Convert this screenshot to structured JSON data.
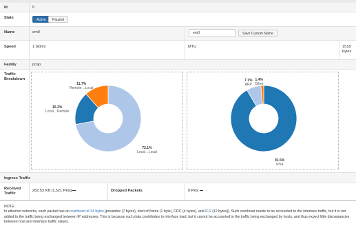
{
  "rows": {
    "id": {
      "label": "Id",
      "value": "0"
    },
    "state": {
      "label": "State",
      "active_label": "Active",
      "paused_label": "Paused"
    },
    "name": {
      "label": "Name",
      "value": "em0",
      "input_value": "em0",
      "save_label": "Save Custom Name"
    },
    "speed": {
      "label": "Speed",
      "value": "1 Gbit/s",
      "mtu_label": "MTU",
      "mtu_value": "1518 bytes"
    },
    "family": {
      "label": "Family",
      "value": "pcap"
    },
    "traffic": {
      "label": "Traffic Breakdown"
    },
    "ingress": {
      "label": "Ingress Traffic"
    },
    "received": {
      "label": "Received Traffic",
      "value": "282.53 KB [1,521 Pkts]",
      "dropped_label": "Dropped Packets",
      "dropped_value": "0 Pkts"
    }
  },
  "note": {
    "title": "NOTE:",
    "text_before": "In ethernet networks, each packet has an ",
    "link1": "overhead of 24 bytes",
    "text_mid1": " [preamble (7 bytes), start of frame (1 byte), CRC (4 bytes), and ",
    "link2": "IFG",
    "text_mid2": " (12 bytes)]. Such overhead needs to be accounted to the interface traffic, but it is not added to the traffic being exchanged between IP addresses. This is because such data contributes to interface load, but it cannot be accounted in the traffic being exchanged by hosts, and thus expect little discrepancies between host and interface traffic values."
  },
  "chart_data": [
    {
      "type": "pie",
      "title": "",
      "slices": [
        {
          "label": "Local→Local",
          "value": 72.1,
          "color": "#aec7e8"
        },
        {
          "label": "Local→Remote",
          "value": 16.2,
          "color": "#1f77b4"
        },
        {
          "label": "Remote→Local",
          "value": 11.7,
          "color": "#ff7f0e"
        }
      ],
      "value_labels": [
        "72.1%",
        "16.2%",
        "11.7%"
      ]
    },
    {
      "type": "pie",
      "title": "",
      "slices": [
        {
          "label": "IPv4",
          "value": 91.5,
          "color": "#1f77b4"
        },
        {
          "label": "ARP",
          "value": 7.1,
          "color": "#aec7e8"
        },
        {
          "label": "Other",
          "value": 1.4,
          "color": "#ff7f0e"
        }
      ],
      "value_labels": [
        "91.5%",
        "7.1%",
        "1.4%"
      ]
    }
  ]
}
